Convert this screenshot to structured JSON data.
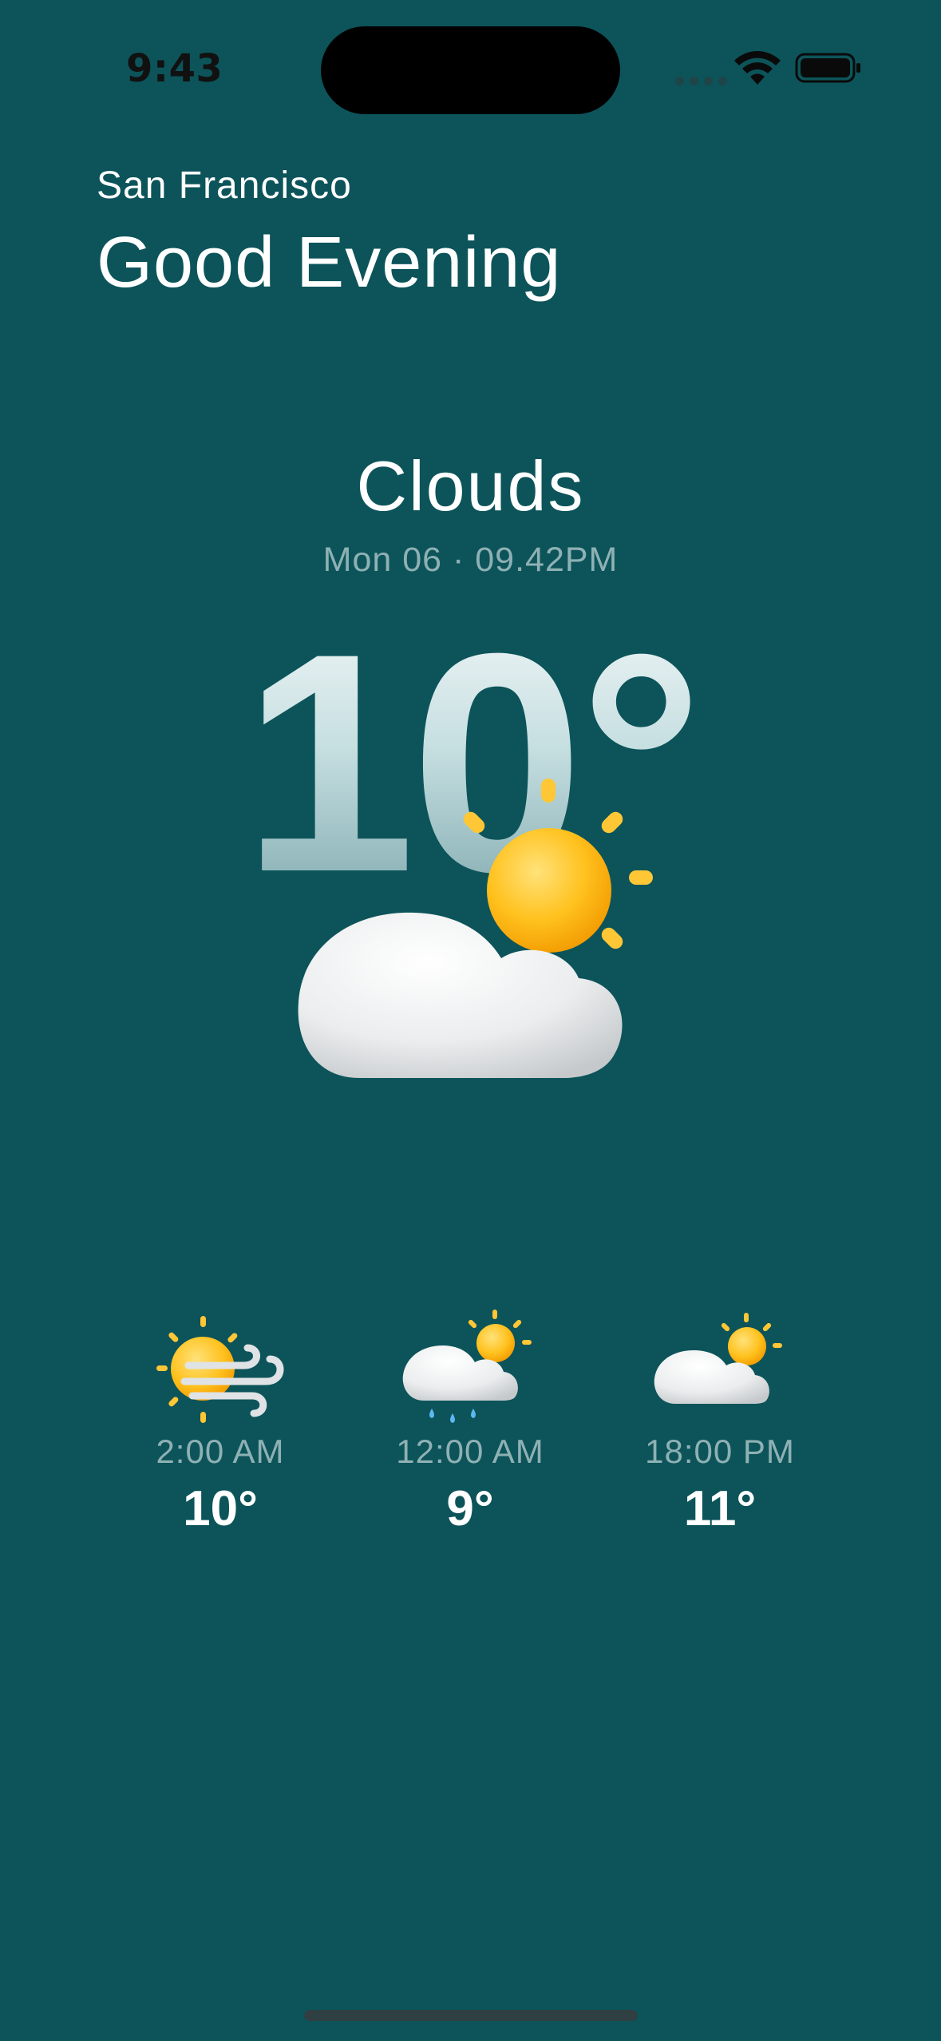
{
  "status_bar": {
    "time": "9:43"
  },
  "header": {
    "city": "San Francisco",
    "greeting": "Good Evening"
  },
  "current": {
    "condition": "Clouds",
    "datetime": "Mon 06 · 09.42PM",
    "temperature": "10°",
    "icon": "sun-behind-cloud-icon"
  },
  "forecast": [
    {
      "time": "2:00 AM",
      "temp": "10°",
      "icon": "sun-wind-icon"
    },
    {
      "time": "12:00 AM",
      "temp": "9°",
      "icon": "rain-cloud-sun-icon"
    },
    {
      "time": "18:00 PM",
      "temp": "11°",
      "icon": "sun-behind-cloud-icon"
    }
  ],
  "colors": {
    "background": "#0c545a",
    "secondary_text": "#8fb1b4",
    "sun": "#ffc21f",
    "cloud": "#eceeef"
  }
}
